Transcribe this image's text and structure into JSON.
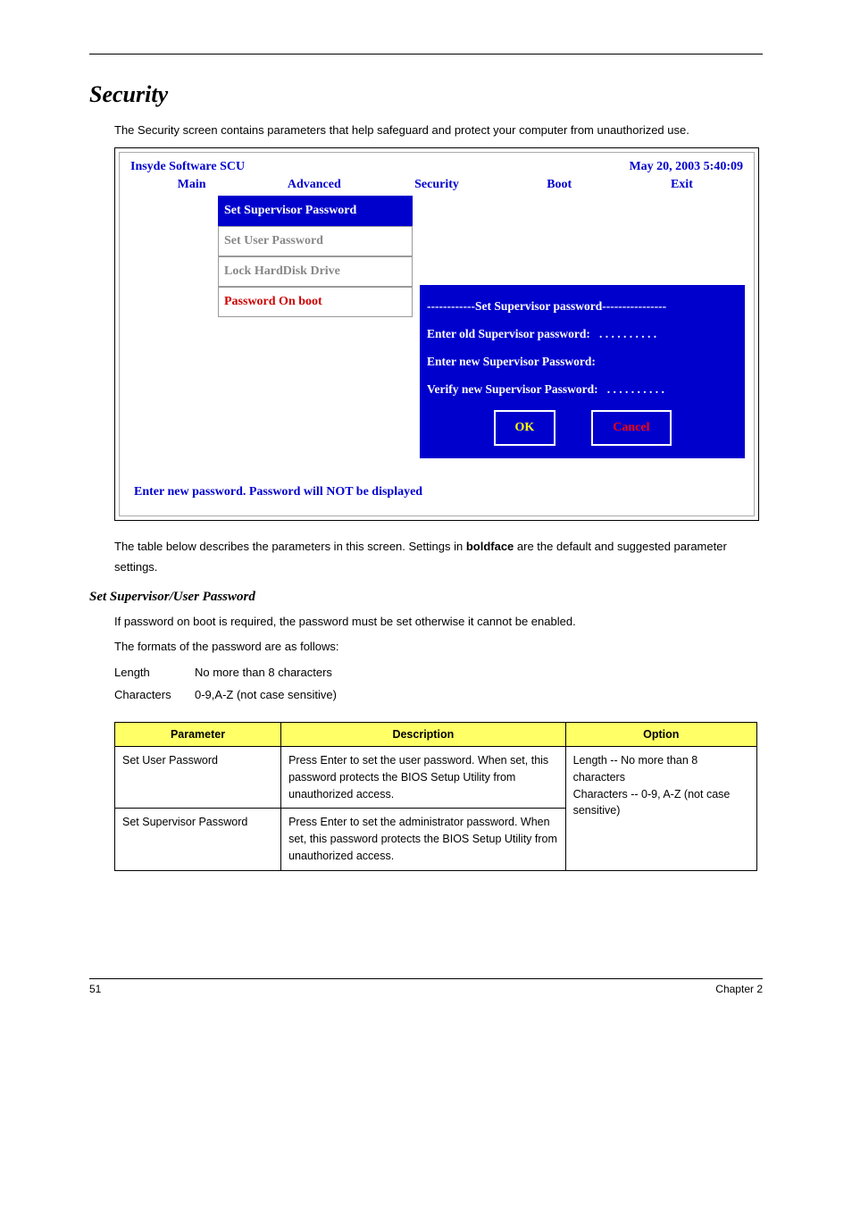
{
  "heading_main": "Security",
  "intro": "The Security screen contains parameters that help safeguard and protect your computer from unauthorized use.",
  "bios": {
    "title_left": "Insyde Software SCU",
    "title_right": "May 20, 2003 5:40:09",
    "menu": {
      "main": "Main",
      "advanced": "Advanced",
      "security": "Security",
      "boot": "Boot",
      "exit": "Exit"
    },
    "items": {
      "set_supervisor": "Set Supervisor Password",
      "set_user": "Set User Password",
      "lock_hdd": "Lock HardDisk Drive",
      "pw_on_boot": "Password On boot"
    },
    "dialog": {
      "header": "------------Set Supervisor password----------------",
      "line1": "Enter old Supervisor password:",
      "dots1": ". . . . . . . . . .",
      "line2": "Enter new Supervisor Password:",
      "line3": "Verify new Supervisor Password:",
      "dots2": ". . . . . . . . . .",
      "ok": "OK",
      "cancel": "Cancel"
    },
    "footer": "Enter new password. Password will NOT be displayed"
  },
  "after_bios_1": "The table below describes the parameters in this screen. Settings in ",
  "after_bios_bold": "boldface",
  "after_bios_2": " are the default and suggested  parameter settings.",
  "heading_sub": "Set Supervisor/User Password",
  "sub_p1": "If password on boot is required, the password must be set otherwise it cannot be enabled.",
  "sub_p2": "The formats of the password are as follows:",
  "kv": {
    "length_k": "Length",
    "length_v": "No more than 8 characters",
    "chars_k": "Characters",
    "chars_v": "0-9,A-Z (not case sensitive)"
  },
  "table": {
    "h_param": "Parameter",
    "h_desc": "Description",
    "h_opt": "Option",
    "r1_p": "Set User Password",
    "r1_d": "Press Enter to set the user password. When set, this password protects the BIOS Setup Utility from unauthorized access.",
    "r2_p": "Set Supervisor Password",
    "r2_d": "Press Enter to set the administrator password. When set, this password protects the BIOS Setup Utility from unauthorized access.",
    "opt_l1": "Length -- No more than 8 characters",
    "opt_l2": "Characters -- 0-9, A-Z (not case sensitive)"
  },
  "foot_left": "51",
  "foot_right": "Chapter 2"
}
